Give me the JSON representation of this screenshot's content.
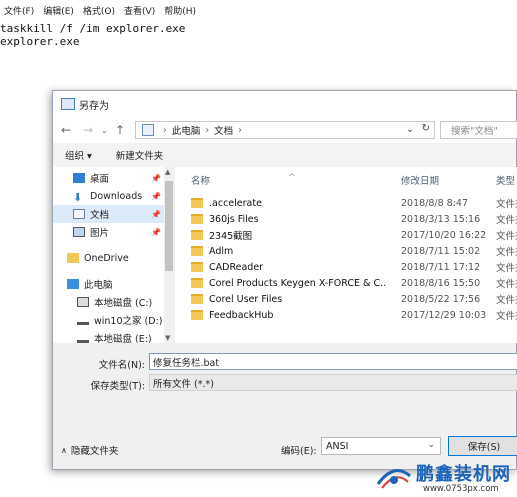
{
  "notepad": {
    "menu": [
      "文件(F)",
      "编辑(E)",
      "格式(O)",
      "查看(V)",
      "帮助(H)"
    ],
    "lines": [
      "taskkill /f /im explorer.exe",
      "explorer.exe"
    ]
  },
  "dialog": {
    "title": "另存为",
    "address": {
      "segments": [
        "此电脑",
        "文档"
      ]
    },
    "search_placeholder": "搜索\"文档\"",
    "toolbar": {
      "organize": "组织 ▾",
      "new_folder": "新建文件夹"
    },
    "nav_items": [
      {
        "label": "桌面",
        "pinned": true
      },
      {
        "label": "Downloads",
        "pinned": true
      },
      {
        "label": "文档",
        "pinned": true,
        "selected": true
      },
      {
        "label": "图片",
        "pinned": true
      },
      {
        "label": "OneDrive"
      },
      {
        "label": "此电脑"
      },
      {
        "label": "本地磁盘 (C:)"
      },
      {
        "label": "win10之家 (D:)"
      },
      {
        "label": "本地磁盘 (E:)"
      }
    ],
    "columns": {
      "name": "名称",
      "date": "修改日期",
      "type": "类型"
    },
    "files": [
      {
        "name": ".accelerate",
        "date": "2018/8/8 8:47",
        "type": "文件夹"
      },
      {
        "name": "360js Files",
        "date": "2018/3/13 15:16",
        "type": "文件夹"
      },
      {
        "name": "2345截图",
        "date": "2017/10/20 16:22",
        "type": "文件夹"
      },
      {
        "name": "Adlm",
        "date": "2018/7/11 15:02",
        "type": "文件夹"
      },
      {
        "name": "CADReader",
        "date": "2018/7/11 17:12",
        "type": "文件夹"
      },
      {
        "name": "Corel Products Keygen X-FORCE & C...",
        "date": "2018/8/16 15:50",
        "type": "文件夹"
      },
      {
        "name": "Corel User Files",
        "date": "2018/5/22 17:56",
        "type": "文件夹"
      },
      {
        "name": "FeedbackHub",
        "date": "2017/12/29 10:03",
        "type": "文件夹"
      }
    ],
    "filename_label": "文件名(N):",
    "filename_value": "修复任务栏.bat",
    "filetype_label": "保存类型(T):",
    "filetype_value": "所有文件 (*.*)",
    "hide_folders": "隐藏文件夹",
    "encoding_label": "编码(E):",
    "encoding_value": "ANSI",
    "save_label": "保存(S)"
  },
  "watermark": {
    "title": "鹏鑫装机网",
    "url": "www.0753px.com"
  },
  "colors": {
    "accent": "#0078d7",
    "folder": "#f2c954",
    "selection": "#dcebfa",
    "watermark": "#1d63b8"
  }
}
